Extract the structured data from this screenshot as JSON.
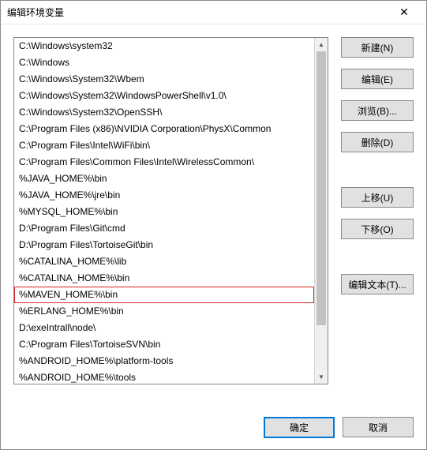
{
  "window": {
    "title": "编辑环境变量"
  },
  "list": {
    "items": [
      "C:\\Windows\\system32",
      "C:\\Windows",
      "C:\\Windows\\System32\\Wbem",
      "C:\\Windows\\System32\\WindowsPowerShell\\v1.0\\",
      "C:\\Windows\\System32\\OpenSSH\\",
      "C:\\Program Files (x86)\\NVIDIA Corporation\\PhysX\\Common",
      "C:\\Program Files\\Intel\\WiFi\\bin\\",
      "C:\\Program Files\\Common Files\\Intel\\WirelessCommon\\",
      "%JAVA_HOME%\\bin",
      "%JAVA_HOME%\\jre\\bin",
      "%MYSQL_HOME%\\bin",
      "D:\\Program Files\\Git\\cmd",
      "D:\\Program Files\\TortoiseGit\\bin",
      "%CATALINA_HOME%\\lib",
      "%CATALINA_HOME%\\bin",
      "%MAVEN_HOME%\\bin",
      "%ERLANG_HOME%\\bin",
      "D:\\exeIntrall\\node\\",
      "C:\\Program Files\\TortoiseSVN\\bin",
      "%ANDROID_HOME%\\platform-tools",
      "%ANDROID_HOME%\\tools"
    ],
    "highlighted_index": 15
  },
  "buttons": {
    "new": "新建(N)",
    "edit": "编辑(E)",
    "browse": "浏览(B)...",
    "delete": "删除(D)",
    "moveup": "上移(U)",
    "movedown": "下移(O)",
    "edittext": "编辑文本(T)..."
  },
  "footer": {
    "ok": "确定",
    "cancel": "取消"
  }
}
